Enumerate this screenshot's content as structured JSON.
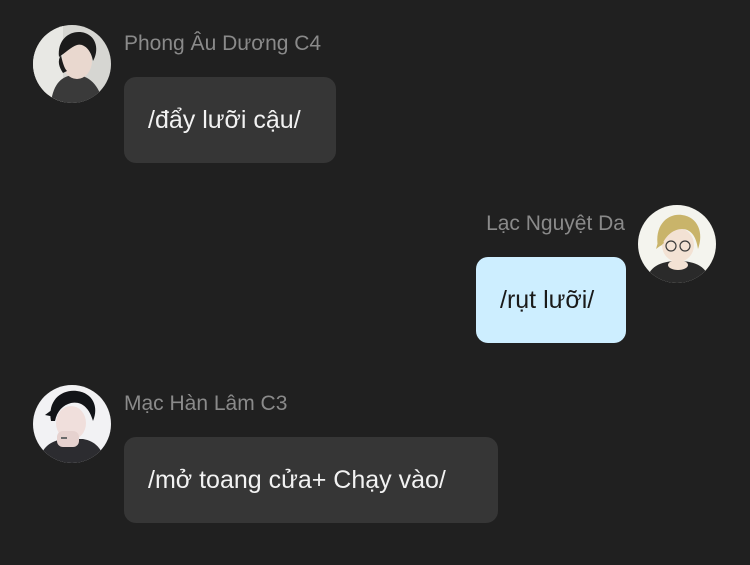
{
  "messages": [
    {
      "sender": "Phong Âu Dương C4",
      "text": "/đẩy lưỡi cậu/",
      "direction": "incoming",
      "avatar_icon": "avatar-dark-hair-man"
    },
    {
      "sender": "Lạc Nguyệt Da",
      "text": "/rụt lưỡi/",
      "direction": "outgoing",
      "avatar_icon": "avatar-blonde-boy"
    },
    {
      "sender": "Mạc Hàn Lâm C3",
      "text": "/mở toang cửa+ Chạy vào/",
      "direction": "incoming",
      "avatar_icon": "avatar-dark-hair-man-hand"
    }
  ],
  "colors": {
    "background": "#202020",
    "incoming_bubble": "#363636",
    "outgoing_bubble": "#cdeeff",
    "sender_name": "#8a8a8a"
  }
}
